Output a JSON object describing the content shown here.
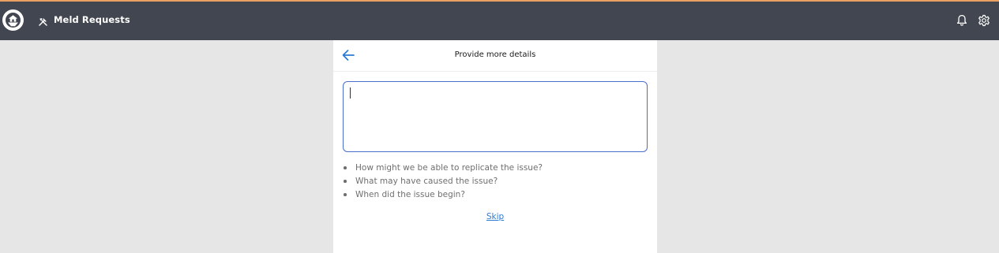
{
  "header": {
    "app_title": "Meld Requests",
    "accent_color": "#e8a063",
    "bar_color": "#424650",
    "icons": [
      "app-logo-icon",
      "tools-icon",
      "bell-icon",
      "gear-icon"
    ]
  },
  "panel": {
    "title": "Provide more details",
    "back_icon": "arrow-left-icon",
    "details_input": {
      "value": "",
      "placeholder": ""
    },
    "tips": [
      "How might we be able to replicate the issue?",
      "What may have caused the issue?",
      "When did the issue begin?"
    ],
    "skip_label": "Skip",
    "link_color": "#2a7bd0",
    "focus_border_color": "#4a6fc8"
  }
}
